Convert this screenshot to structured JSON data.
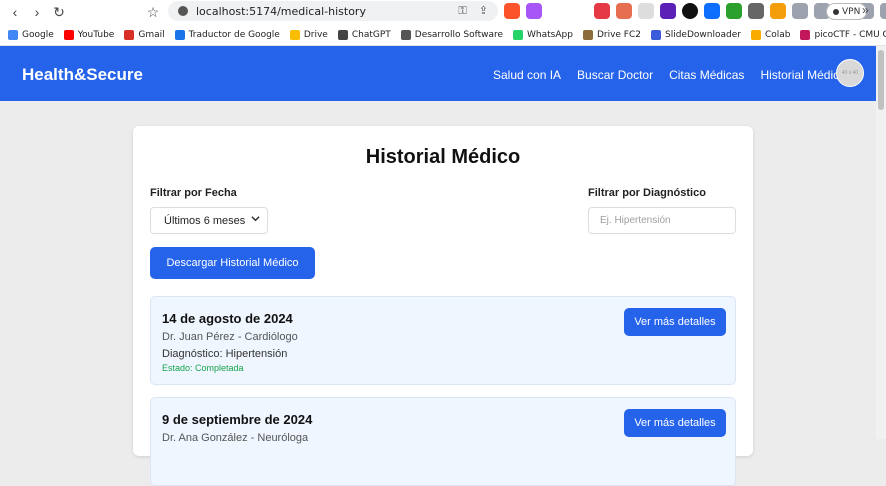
{
  "browser": {
    "url": "localhost:5174/medical-history",
    "vpn_label": "VPN",
    "more": "»",
    "back": "‹",
    "forward": "›",
    "reload": "↻",
    "bookmark_star": "☆"
  },
  "bookmarks": [
    {
      "label": "Google",
      "color": "#4285f4"
    },
    {
      "label": "YouTube",
      "color": "#ff0000"
    },
    {
      "label": "Gmail",
      "color": "#d93025"
    },
    {
      "label": "Traductor de Google",
      "color": "#1a73e8"
    },
    {
      "label": "Drive",
      "color": "#fbbc04"
    },
    {
      "label": "ChatGPT",
      "color": "#444444"
    },
    {
      "label": "Desarrollo Software",
      "color": "#555555"
    },
    {
      "label": "WhatsApp",
      "color": "#25d366"
    },
    {
      "label": "Drive FC2",
      "color": "#8a6d3b"
    },
    {
      "label": "SlideDownloader",
      "color": "#3b5bdb"
    },
    {
      "label": "Colab",
      "color": "#f9ab00"
    },
    {
      "label": "picoCTF - CMU Cyb...",
      "color": "#c2185b"
    }
  ],
  "app": {
    "brand": "Health&Secure",
    "nav": [
      "Salud con IA",
      "Buscar Doctor",
      "Citas Médicas",
      "Historial Médico"
    ],
    "avatar_text": "40 x 40",
    "accent": "#2563eb"
  },
  "page": {
    "title": "Historial Médico",
    "filter_date_label": "Filtrar por Fecha",
    "filter_date_value": "Últimos 6 meses",
    "filter_diag_label": "Filtrar por Diagnóstico",
    "filter_diag_placeholder": "Ej. Hipertensión",
    "download_button": "Descargar Historial Médico"
  },
  "records": [
    {
      "date": "14 de agosto de 2024",
      "doctor": "Dr. Juan Pérez - Cardiólogo",
      "diagnosis": "Diagnóstico: Hipertensión",
      "status": "Estado: Completada",
      "button": "Ver más detalles"
    },
    {
      "date": "9 de septiembre de 2024",
      "doctor": "Dr. Ana González - Neuróloga",
      "button": "Ver más detalles"
    }
  ]
}
